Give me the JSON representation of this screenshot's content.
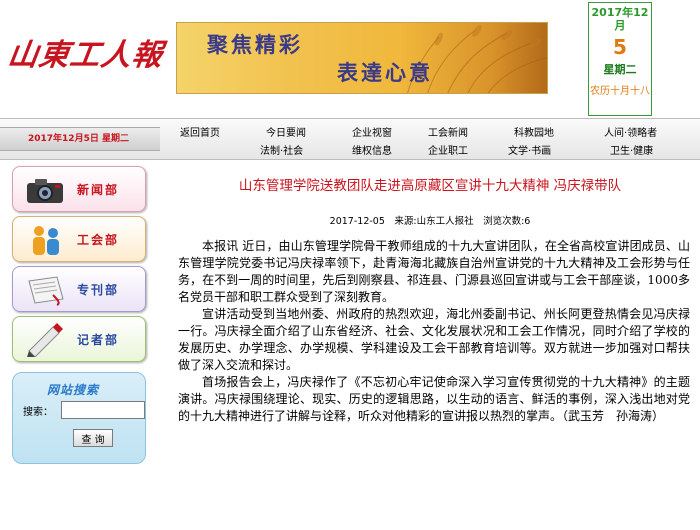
{
  "header": {
    "logo_text": "山東工人報",
    "banner": {
      "slogan1": "聚焦精彩",
      "slogan2": "表達心意"
    },
    "date": {
      "year_month": "2017年12月",
      "day": "5",
      "weekday": "星期二",
      "lunar": "农历十月十八"
    }
  },
  "navbar": {
    "date_label": "2017年12月5日 星期二",
    "links": [
      [
        "返回首页",
        ""
      ],
      [
        "今日要闻",
        "法制·社会"
      ],
      [
        "企业视窗",
        "维权信息"
      ],
      [
        "工会新闻",
        "企业职工"
      ],
      [
        "科教园地",
        "文学·书画"
      ],
      [
        "人间·领略者",
        "卫生·健康"
      ]
    ]
  },
  "sidebar": {
    "buttons": [
      {
        "label": "新闻部",
        "icon": "camera-icon"
      },
      {
        "label": "工会部",
        "icon": "people-icon"
      },
      {
        "label": "专刊部",
        "icon": "scroll-icon"
      },
      {
        "label": "记者部",
        "icon": "pen-icon"
      }
    ],
    "search": {
      "title": "网站搜索",
      "label": "搜索：",
      "value": "",
      "button": "查 询"
    }
  },
  "article": {
    "title": "山东管理学院送教团队走进高原藏区宣讲十九大精神 冯庆禄带队",
    "meta": "2017-12-05　来源:山东工人报社　浏览次数:6",
    "paragraphs": [
      "本报讯 近日，由山东管理学院骨干教师组成的十九大宣讲团队，在全省高校宣讲团成员、山东管理学院党委书记冯庆禄率领下，赴青海海北藏族自治州宣讲党的十九大精神及工会形势与任务，在不到一周的时间里，先后到刚察县、祁连县、门源县巡回宣讲或与工会干部座谈，1000多名党员干部和职工群众受到了深刻教育。",
      "宣讲活动受到当地州委、州政府的热烈欢迎，海北州委副书记、州长阿更登热情会见冯庆禄一行。冯庆禄全面介绍了山东省经济、社会、文化发展状况和工会工作情况，同时介绍了学校的发展历史、办学理念、办学规模、学科建设及工会干部教育培训等。双方就进一步加强对口帮扶做了深入交流和探讨。",
      "首场报告会上，冯庆禄作了《不忘初心牢记使命深入学习宣传贯彻党的十九大精神》的主题演讲。冯庆禄围绕理论、现实、历史的逻辑思路，以生动的语言、鲜活的事例，深入浅出地对党的十九大精神进行了讲解与诠释，听众对他精彩的宣讲报以热烈的掌声。（武玉芳　孙海涛）"
    ]
  }
}
